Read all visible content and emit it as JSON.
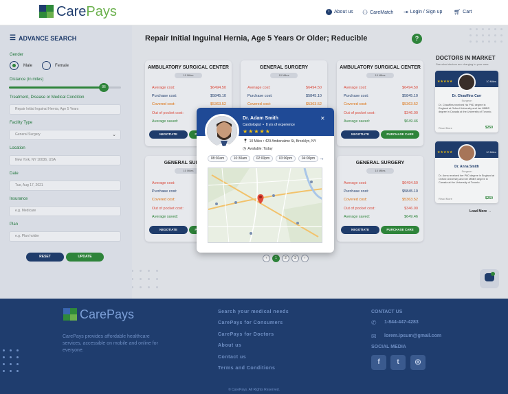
{
  "brand": {
    "name_part1": "Care",
    "name_part2": "Pays"
  },
  "nav": {
    "about": "About us",
    "caremodal": "CareMatch",
    "login": "Login / Sign up",
    "cart": "Cart"
  },
  "sidebar": {
    "title": "ADVANCE SEARCH",
    "gender_label": "Gender",
    "gender_male": "Male",
    "gender_female": "Female",
    "distance_label": "Distance (in miles)",
    "distance_value": "86",
    "treatment_label": "Treatment, Disease or Medical Condition",
    "treatment_value": "Repair Initial Inguinal Hernia, Age 5 Years",
    "facility_label": "Facility Type",
    "facility_value": "General Surgery",
    "location_label": "Location",
    "location_value": "New York, NY 10036, USA",
    "date_label": "Date",
    "date_value": "Tue, Aug 17, 2021",
    "insurance_label": "Insurance",
    "insurance_placeholder": "e.g. Medicare",
    "plan_label": "Plan",
    "plan_placeholder": "e.g. Plan holder",
    "reset": "RESET",
    "update": "UPDATE"
  },
  "main": {
    "title": "Repair Initial Inguinal Hernia, Age 5 Years Or Older; Reducible",
    "help": "?"
  },
  "card_labels": {
    "avg_cost": "Average cost:",
    "purchase_cost": "Purchase cost:",
    "covered_cost": "Covered cost:",
    "oop_cost": "Out of pocket cost:",
    "avg_saved": "Average saved:",
    "negotiate": "NEGOTIATE",
    "purchase": "PURCHASE CARE"
  },
  "cards": [
    {
      "title": "AMBULATORY SURGICAL CENTER",
      "miles": "10 Miles",
      "avg": "$6494.50",
      "purchase": "$5845.10",
      "covered": "$5363.52",
      "oop": "$346.00",
      "saved": "$649.46"
    },
    {
      "title": "GENERAL SURGERY",
      "miles": "10 Miles",
      "avg": "$6494.50",
      "purchase": "$5845.10",
      "covered": "$5363.52",
      "oop": "$346.00",
      "saved": "$649.46"
    },
    {
      "title": "AMBULATORY SURGICAL CENTER",
      "miles": "10 Miles",
      "avg": "$6494.50",
      "purchase": "$5845.10",
      "covered": "$5363.52",
      "oop": "$346.00",
      "saved": "$649.46"
    },
    {
      "title": "GENERAL SURGERY",
      "miles": "10 Miles",
      "avg": "$6494.50",
      "purchase": "$5845.10",
      "covered": "$5363.52",
      "oop": "$346.00",
      "saved": "$649.46"
    },
    {
      "title": "GENERAL SURGERY",
      "miles": "10 Miles",
      "avg": "$6494.50",
      "purchase": "$5845.10",
      "covered": "$5363.52",
      "oop": "$346.00",
      "saved": "$649.46"
    }
  ],
  "pagination": {
    "prev": "‹",
    "p1": "1",
    "p2": "2",
    "p3": "3",
    "next": "›"
  },
  "right_panel": {
    "title": "DOCTORS IN MARKET",
    "subtitle": "See what doctors are charging in your area",
    "doctors": [
      {
        "stars": "★★★★★",
        "miles": "10 Miles",
        "name": "Dr. Chauffins Carr",
        "specialty": "Surgeon",
        "desc": "Dr. Chauffins received his PhD degree in England at Oxford University and her MBBS degree in Canada at the University of Toronto.",
        "more": "Read More",
        "price": "$250"
      },
      {
        "stars": "★★★★★",
        "miles": "10 Miles",
        "name": "Dr. Anna Smith",
        "specialty": "Surgeon",
        "desc": "Dr. Anna received her PhD degree in England at Oxford University and her MBBS degree in Canada at the University of Toronto.",
        "more": "Read More",
        "price": "$250"
      }
    ],
    "load_more": "Load More →"
  },
  "modal": {
    "name": "Dr. Adam Smith",
    "specialty": "Cardiologist",
    "experience": "8 yrs of experience",
    "stars": "★★★★★",
    "address": "10 Miles • 429 Ambonalme St, Brooklyn, NY",
    "availability": "Available: Today",
    "close": "✕",
    "slots": [
      "08:30am",
      "10:30am",
      "02:00pm",
      "03:00pm",
      "04:00pm"
    ]
  },
  "footer": {
    "tagline": "CarePays provides affordable healthcare services, accessible on mobile and online for everyone.",
    "links": [
      "Search your medical needs",
      "CarePays for Consumers",
      "CarePays for Doctors",
      "About us",
      "Contact us",
      "Terms and Conditions"
    ],
    "contact_head": "CONTACT US",
    "phone": "1-844-447-4283",
    "email": "lorem.ipsum@gmail.com",
    "social_head": "SOCIAL MEDIA",
    "copyright": "© CarePays. All Rights Reserved."
  },
  "colors": {
    "navy": "#1f3d6e",
    "green": "#2f8a3a",
    "modal_header": "#1f4a96",
    "footer": "#1f3d6e"
  }
}
